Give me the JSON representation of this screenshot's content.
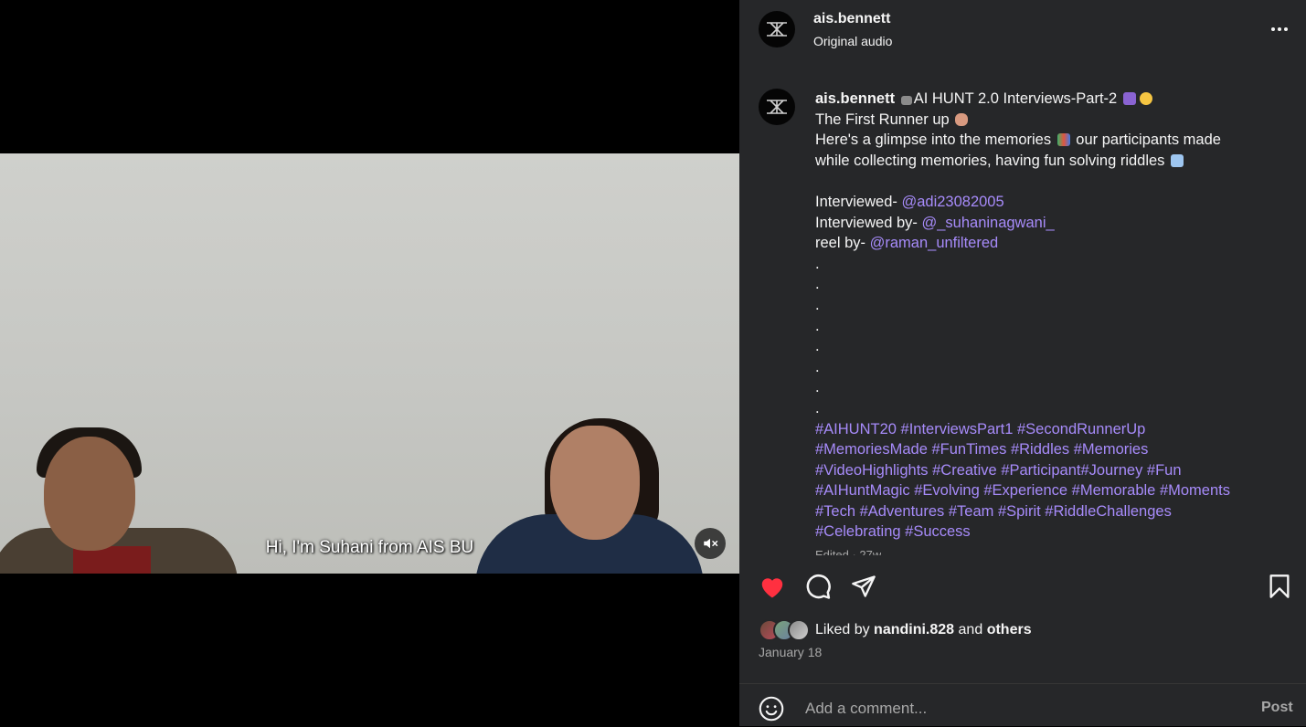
{
  "video": {
    "subtitle": "Hi, I'm Suhani from AIS BU",
    "mute_icon": "speaker-muted-icon"
  },
  "header": {
    "username": "ais.bennett",
    "audio": "Original audio",
    "more_icon": "more-horizontal-icon"
  },
  "caption": {
    "username": "ais.bennett",
    "title": "AI HUNT 2.0 Interviews-Part-2",
    "line2": "The First Runner up",
    "line3a": "Here's a glimpse into the memories",
    "line3b": "our participants made",
    "line4": "while collecting memories, having fun solving riddles",
    "interviewed_label": "Interviewed-",
    "interviewed_handle": "@adi23082005",
    "interviewed_by_label": "Interviewed by-",
    "interviewed_by_handle": "@_suhaninagwani_",
    "reel_by_label": "reel by-",
    "reel_by_handle": "@raman_unfiltered",
    "dots": [
      ".",
      ".",
      ".",
      ".",
      ".",
      ".",
      ".",
      "."
    ],
    "hashtag_lines": [
      "#AIHUNT20 #InterviewsPart1 #SecondRunnerUp",
      "#MemoriesMade #FunTimes #Riddles #Memories",
      "#VideoHighlights #Creative #Participant#Journey #Fun",
      "#AIHuntMagic #Evolving #Experience #Memorable #Moments",
      "#Tech #Adventures #Team #Spirit #RiddleChallenges",
      "#Celebrating #Success"
    ],
    "edited": "Edited · 27w"
  },
  "actions": {
    "like_icon": "heart-filled-icon",
    "comment_icon": "comment-icon",
    "share_icon": "share-icon",
    "save_icon": "bookmark-icon"
  },
  "likes": {
    "prefix": "Liked by",
    "user": "nandini.828",
    "conj": "and",
    "others": "others"
  },
  "date": "January 18",
  "comment": {
    "placeholder": "Add a comment...",
    "post_label": "Post",
    "emoji_icon": "smiley-icon"
  },
  "colors": {
    "panel_bg": "#262729",
    "link": "#a78bfa",
    "like_red": "#ff3040",
    "muted_text": "#a8a8a8"
  }
}
